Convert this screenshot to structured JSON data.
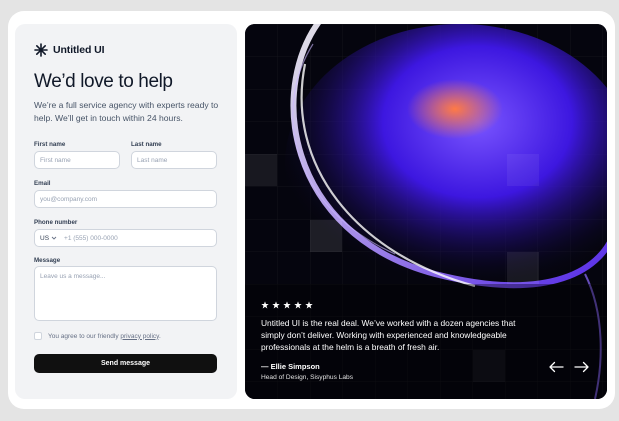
{
  "brand": {
    "name": "Untitled UI",
    "icon": "asterisk-logo-icon"
  },
  "form": {
    "heading": "We’d love to help",
    "subtext": "We’re a full service agency with experts ready to help. We’ll get in touch within 24 hours.",
    "first_name": {
      "label": "First name",
      "placeholder": "First name"
    },
    "last_name": {
      "label": "Last name",
      "placeholder": "Last name"
    },
    "email": {
      "label": "Email",
      "placeholder": "you@company.com"
    },
    "phone": {
      "label": "Phone number",
      "country": "US",
      "placeholder": "+1 (555) 000-0000"
    },
    "message": {
      "label": "Message",
      "placeholder": "Leave us a message..."
    },
    "agree_prefix": "You agree to our friendly ",
    "agree_link": "privacy policy",
    "agree_suffix": ".",
    "submit_label": "Send message"
  },
  "testimonial": {
    "rating": 5,
    "quote": "Untitled UI is the real deal. We’ve worked with a dozen agencies that simply don’t deliver. Working with experienced and knowledgeable professionals at the helm is a breath of fresh air.",
    "author": "— Ellie Simpson",
    "role": "Head of Design, Sisyphus Labs"
  },
  "colors": {
    "accent": "#101010",
    "glow": "#5b2bff",
    "highlight": "#ff6a3d"
  }
}
